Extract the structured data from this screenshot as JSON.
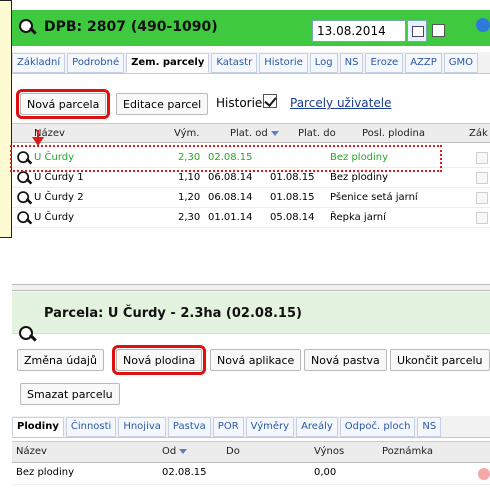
{
  "header": {
    "title": "DPB: 2807 (490-1090)",
    "date_value": "13.08.2014",
    "icon": "search-icon",
    "accent_color": "#3fc93f"
  },
  "top_tabs": [
    {
      "label": "Základní",
      "active": false
    },
    {
      "label": "Podrobné",
      "active": false
    },
    {
      "label": "Zem. parcely",
      "active": true
    },
    {
      "label": "Katastr",
      "active": false
    },
    {
      "label": "Historie",
      "active": false
    },
    {
      "label": "Log",
      "active": false
    },
    {
      "label": "NS",
      "active": false
    },
    {
      "label": "Eroze",
      "active": false
    },
    {
      "label": "AZZP",
      "active": false
    },
    {
      "label": "GMO",
      "active": false
    }
  ],
  "toolbar": {
    "nova_parcela": "Nová parcela",
    "editace_parcel": "Editace parcel",
    "historie_label": "Historie",
    "historie_checked": true,
    "parcely_link": "Parcely uživatele"
  },
  "parcel_grid": {
    "columns": {
      "nazev": "Název",
      "vym": "Vým.",
      "plat_od": "Plat. od",
      "plat_do": "Plat. do",
      "posl_plodina": "Posl. plodina",
      "zak": "Zák"
    },
    "rows": [
      {
        "nazev": "U Čurdy",
        "vym": "2,30",
        "plat_od": "02.08.15",
        "plat_do": "",
        "plodina": "Bez plodiny",
        "highlight": true
      },
      {
        "nazev": "U Čurdy 1",
        "vym": "1,10",
        "plat_od": "06.08.14",
        "plat_do": "01.08.15",
        "plodina": "Bez plodiny",
        "highlight": false
      },
      {
        "nazev": "U Čurdy 2",
        "vym": "1,20",
        "plat_od": "06.08.14",
        "plat_do": "01.08.15",
        "plodina": "Pšenice setá jarní",
        "highlight": false
      },
      {
        "nazev": "U Čurdy",
        "vym": "2,30",
        "plat_od": "01.01.14",
        "plat_do": "05.08.14",
        "plodina": "Řepka jarní",
        "highlight": false
      }
    ]
  },
  "parcela": {
    "title": "Parcela: U Čurdy - 2.3ha (02.08.15)",
    "buttons": {
      "zmena": "Změna údajů",
      "nova_plodina": "Nová plodina",
      "nova_aplikace": "Nová aplikace",
      "nova_pastva": "Nová pastva",
      "ukoncit": "Ukončit parcelu",
      "smazat": "Smazat parcelu"
    }
  },
  "bottom_tabs": [
    {
      "label": "Plodiny",
      "active": true
    },
    {
      "label": "Činnosti",
      "active": false
    },
    {
      "label": "Hnojiva",
      "active": false
    },
    {
      "label": "Pastva",
      "active": false
    },
    {
      "label": "POR",
      "active": false
    },
    {
      "label": "Výměry",
      "active": false
    },
    {
      "label": "Areály",
      "active": false
    },
    {
      "label": "Odpoč. ploch",
      "active": false
    },
    {
      "label": "NS",
      "active": false
    }
  ],
  "plodiny_grid": {
    "columns": {
      "nazev": "Název",
      "od": "Od",
      "do": "Do",
      "vynos": "Výnos",
      "poznamka": "Poznámka"
    },
    "rows": [
      {
        "nazev": "Bez plodiny",
        "od": "02.08.15",
        "do": "",
        "vynos": "0,00",
        "poznamka": ""
      }
    ]
  }
}
